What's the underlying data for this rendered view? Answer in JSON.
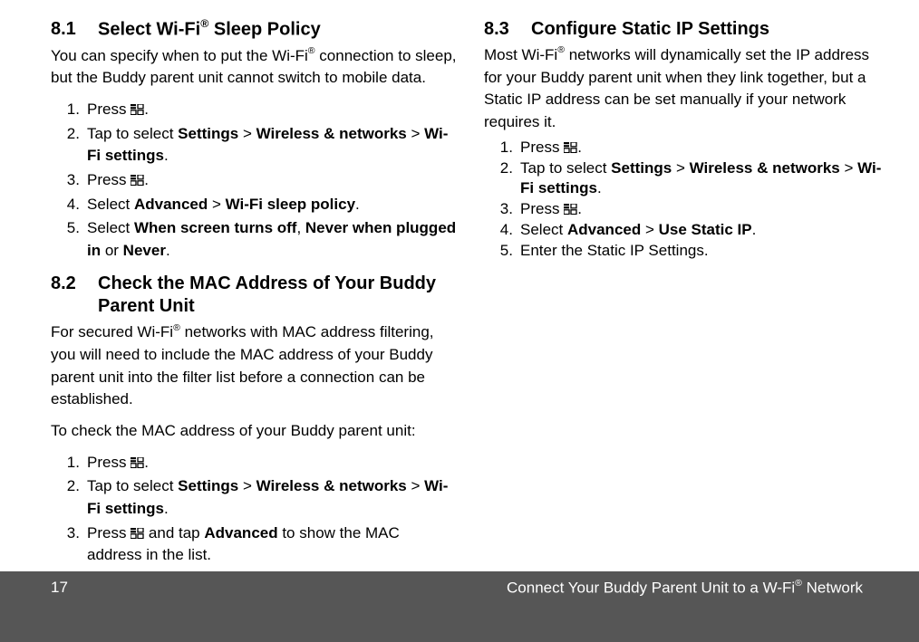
{
  "sections": {
    "s81": {
      "num": "8.1",
      "title_a": "Select Wi-Fi",
      "title_b": " Sleep Policy",
      "intro_a": "You can specify when to put the Wi-Fi",
      "intro_b": " connection to sleep, but the Buddy parent unit cannot switch to mobile data.",
      "step1": "Press ",
      "step2_a": "Tap to select ",
      "step2_b": "Settings",
      "step2_c": "Wireless & networks",
      "step2_d": "Wi-Fi settings",
      "step3": "Press ",
      "step4_a": "Select ",
      "step4_b": "Advanced",
      "step4_c": "Wi-Fi sleep policy",
      "step5_a": "Select ",
      "step5_b": "When screen turns off",
      "step5_c": "Never when plugged in",
      "step5_d": "Never"
    },
    "s82": {
      "num": "8.2",
      "title": "Check the MAC Address of Your Buddy Parent Unit",
      "intro_a": "For secured Wi-Fi",
      "intro_b": " networks with MAC address filtering, you will need to include the MAC address of your Buddy parent unit into the filter list before a connection can be established.",
      "intro2": "To check the MAC address of your Buddy parent unit:",
      "step1": "Press ",
      "step2_a": "Tap to select ",
      "step2_b": "Settings",
      "step2_c": "Wireless & networks",
      "step2_d": "Wi-Fi settings",
      "step3_a": "Press ",
      "step3_b": " and tap ",
      "step3_c": "Advanced",
      "step3_d": " to show the MAC address in the list."
    },
    "s83": {
      "num": "8.3",
      "title": "Configure Static IP Settings",
      "intro_a": "Most Wi-Fi",
      "intro_b": " networks will dynamically set the IP address for your Buddy parent unit when they link together, but a Static IP address can be set manually if your network requires it.",
      "step1": "Press ",
      "step2_a": "Tap to select ",
      "step2_b": "Settings",
      "step2_c": "Wireless & networks",
      "step2_d": "Wi-Fi settings",
      "step3": "Press ",
      "step4_a": "Select ",
      "step4_b": "Advanced",
      "step4_c": "Use Static IP",
      "step5": "Enter the Static IP Settings."
    }
  },
  "punct": {
    "gt": " > ",
    "period": ".",
    "comma": ", ",
    "or": " or "
  },
  "footer": {
    "page_num": "17",
    "title_a": "Connect Your Buddy Parent Unit to a W-Fi",
    "title_b": " Network"
  }
}
